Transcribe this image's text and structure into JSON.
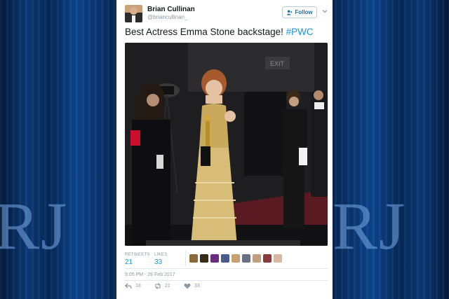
{
  "background": {
    "watermark_text": "RJRJ",
    "accent": "#0c4590"
  },
  "tweet": {
    "author_name": "Brian Cullinan",
    "author_handle": "@briancullinan_",
    "follow_label": "Follow",
    "text_main": "Best Actress Emma Stone backstage! ",
    "hashtag": "#PWC",
    "photo_exit_sign": "EXIT",
    "retweets_label": "RETWEETS",
    "retweets_count": "21",
    "likes_label": "LIKES",
    "likes_count": "33",
    "timestamp": "9:05 PM - 26 Feb 2017",
    "reply_count": "18",
    "retweet_count": "21",
    "like_count": "33",
    "link_color": "#1b95e0",
    "liker_avatar_colors": [
      "#8a6a3a",
      "#3a2a18",
      "#6a2a80",
      "#4a5a8a",
      "#c8a070",
      "#6a7080",
      "#c0a080",
      "#8a3a3a",
      "#d8b8a0"
    ]
  }
}
